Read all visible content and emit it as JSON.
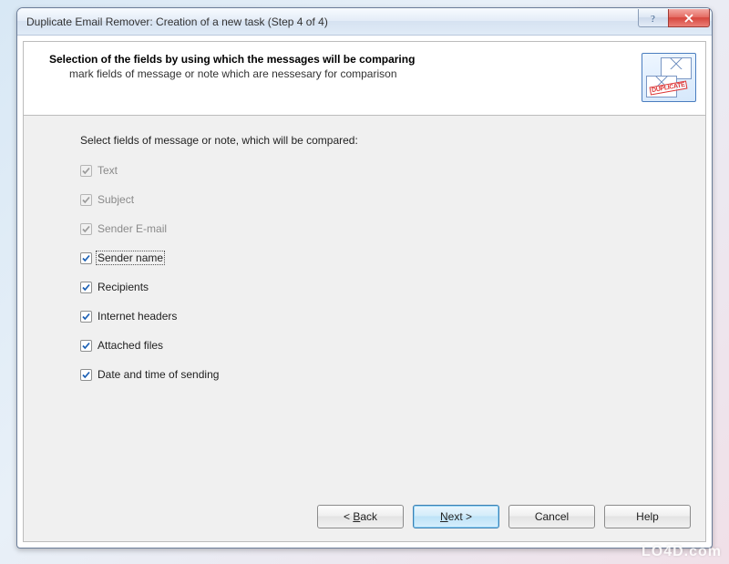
{
  "window": {
    "title": "Duplicate Email Remover: Creation of a new task (Step 4 of 4)"
  },
  "header": {
    "title": "Selection of the fields by using which the messages will be comparing",
    "subtitle": "mark fields of message or note which are nessesary for comparison",
    "stamp": "DUPLICATE"
  },
  "body": {
    "instruction": "Select fields of message or note, which will be compared:",
    "fields": [
      {
        "label": "Text",
        "checked": true,
        "enabled": false,
        "focused": false
      },
      {
        "label": "Subject",
        "checked": true,
        "enabled": false,
        "focused": false
      },
      {
        "label": "Sender E-mail",
        "checked": true,
        "enabled": false,
        "focused": false
      },
      {
        "label": "Sender name",
        "checked": true,
        "enabled": true,
        "focused": true
      },
      {
        "label": "Recipients",
        "checked": true,
        "enabled": true,
        "focused": false
      },
      {
        "label": "Internet headers",
        "checked": true,
        "enabled": true,
        "focused": false
      },
      {
        "label": "Attached files",
        "checked": true,
        "enabled": true,
        "focused": false
      },
      {
        "label": "Date and time of sending",
        "checked": true,
        "enabled": true,
        "focused": false
      }
    ]
  },
  "buttons": {
    "back": "< Back",
    "next": "Next >",
    "cancel": "Cancel",
    "help": "Help"
  },
  "watermark": "LO4D.com"
}
